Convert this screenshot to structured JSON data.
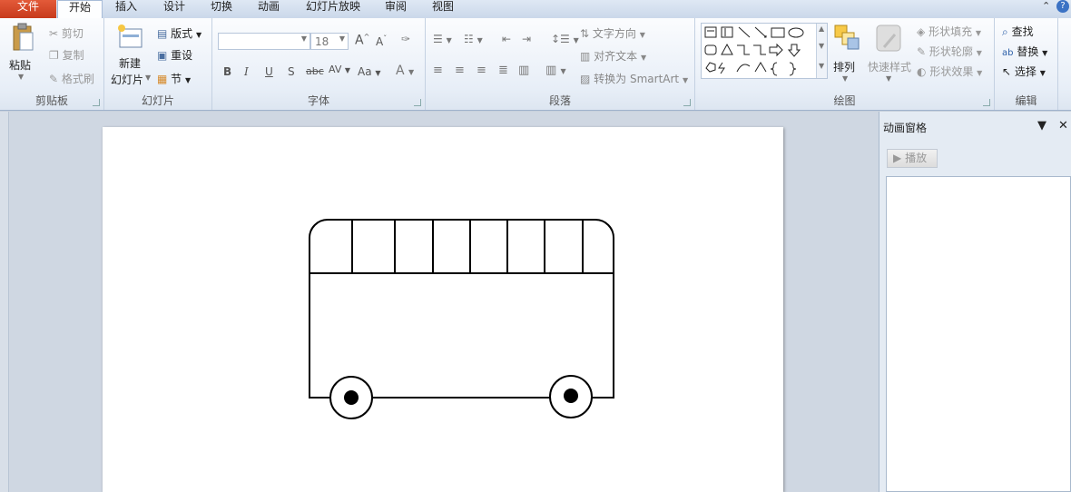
{
  "tabs": {
    "file": "文件",
    "home": "开始",
    "insert": "插入",
    "design": "设计",
    "transitions": "切换",
    "animations": "动画",
    "slideshow": "幻灯片放映",
    "review": "审阅",
    "view": "视图"
  },
  "clipboard": {
    "paste": "粘贴",
    "cut": "剪切",
    "copy": "复制",
    "format_painter": "格式刷",
    "label": "剪贴板"
  },
  "slides": {
    "new_line1": "新建",
    "new_line2": "幻灯片",
    "layout": "版式",
    "reset": "重设",
    "section": "节",
    "label": "幻灯片"
  },
  "font": {
    "size": "18",
    "grow": "A",
    "shrink": "A",
    "bold": "B",
    "italic": "I",
    "underline": "U",
    "shadow": "S",
    "strike": "abc",
    "spacing": "AV",
    "case": "Aa",
    "color": "A",
    "label": "字体"
  },
  "paragraph": {
    "text_direction": "文字方向",
    "align_text": "对齐文本",
    "smartart": "转换为 SmartArt",
    "label": "段落"
  },
  "drawing": {
    "arrange": "排列",
    "quick_styles": "快速样式",
    "shape_fill": "形状填充",
    "shape_outline": "形状轮廓",
    "shape_effects": "形状效果",
    "label": "绘图"
  },
  "editing": {
    "find": "查找",
    "replace": "替换",
    "select": "选择",
    "label": "编辑"
  },
  "animation_pane": {
    "title": "动画窗格",
    "play": "播放"
  },
  "colors": {
    "file_tab": "#d04a2a",
    "ribbon_bg": "#e7eef7",
    "pane_bg": "#e4ebf3",
    "slide_bg": "#ffffff"
  }
}
